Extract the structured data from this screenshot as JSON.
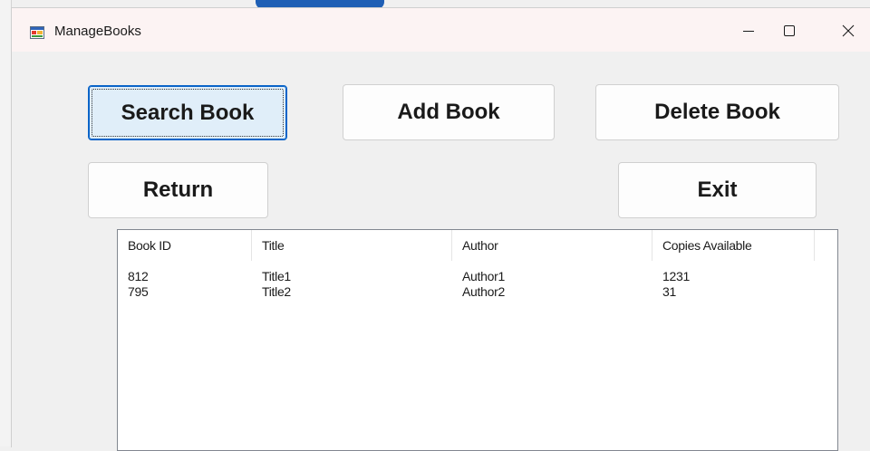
{
  "window": {
    "title": "ManageBooks"
  },
  "buttons": {
    "search": "Search Book",
    "add": "Add Book",
    "delete": "Delete Book",
    "return": "Return",
    "exit": "Exit"
  },
  "books_table": {
    "columns": [
      "Book ID",
      "Title",
      "Author",
      "Copies Available"
    ],
    "rows": [
      [
        "812",
        "Title1",
        "Author1",
        "1231"
      ],
      [
        "795",
        "Title2",
        "Author2",
        "31"
      ]
    ]
  },
  "colors": {
    "titlebar": "#fcf3f3",
    "focused_button_bg": "#e0eef9",
    "focused_button_border": "#0a64c8"
  }
}
